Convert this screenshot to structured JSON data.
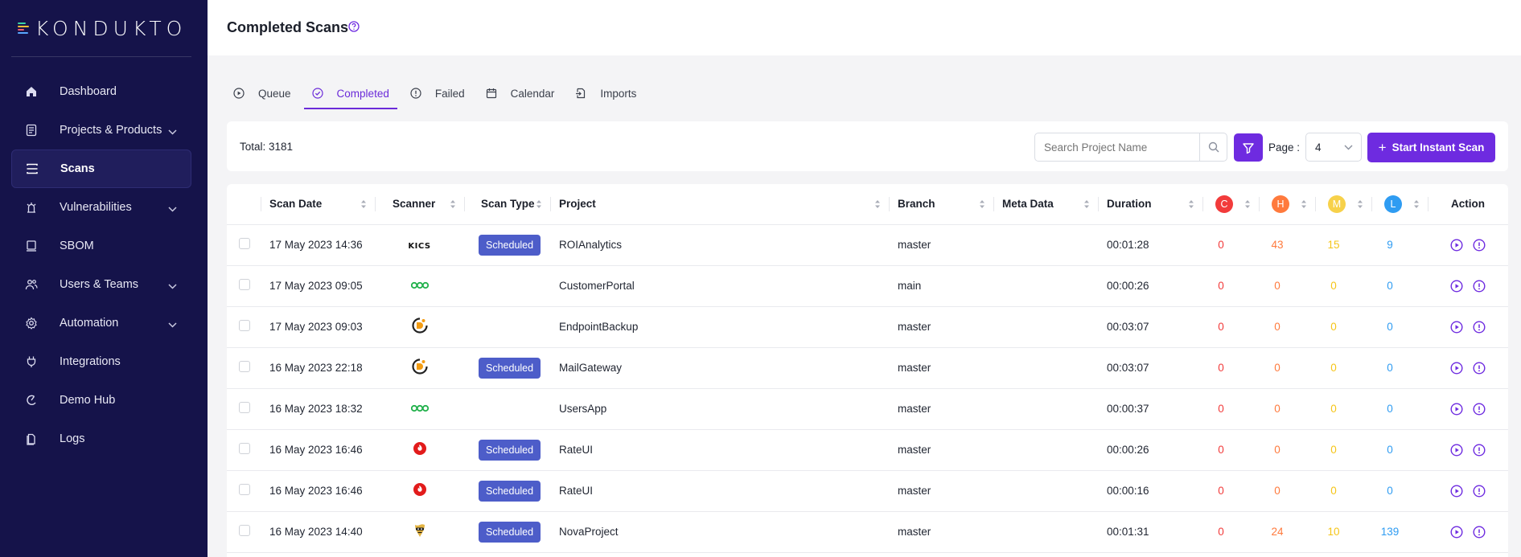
{
  "brand": {
    "name": "KONDUKTO"
  },
  "sidebar": {
    "items": [
      {
        "label": "Dashboard",
        "icon": "home-icon",
        "active": false,
        "chevron": false
      },
      {
        "label": "Projects & Products",
        "icon": "document-list-icon",
        "active": false,
        "chevron": true
      },
      {
        "label": "Scans",
        "icon": "scan-icon",
        "active": true,
        "chevron": false
      },
      {
        "label": "Vulnerabilities",
        "icon": "bug-icon",
        "active": false,
        "chevron": true
      },
      {
        "label": "SBOM",
        "icon": "monitor-icon",
        "active": false,
        "chevron": false
      },
      {
        "label": "Users & Teams",
        "icon": "users-icon",
        "active": false,
        "chevron": true
      },
      {
        "label": "Automation",
        "icon": "gear-icon",
        "active": false,
        "chevron": true
      },
      {
        "label": "Integrations",
        "icon": "plug-icon",
        "active": false,
        "chevron": false
      },
      {
        "label": "Demo Hub",
        "icon": "demo-icon",
        "active": false,
        "chevron": false
      },
      {
        "label": "Logs",
        "icon": "file-icon",
        "active": false,
        "chevron": false
      }
    ]
  },
  "header": {
    "title": "Completed Scans"
  },
  "tabs": [
    {
      "label": "Queue",
      "icon": "play-circle-icon",
      "active": false
    },
    {
      "label": "Completed",
      "icon": "check-circle-icon",
      "active": true
    },
    {
      "label": "Failed",
      "icon": "info-circle-icon",
      "active": false
    },
    {
      "label": "Calendar",
      "icon": "calendar-icon",
      "active": false
    },
    {
      "label": "Imports",
      "icon": "import-icon",
      "active": false
    }
  ],
  "toolbar": {
    "total": "Total: 3181",
    "search_placeholder": "Search Project Name",
    "page_label": "Page :",
    "page_value": "4",
    "start_label": "Start Instant Scan"
  },
  "table": {
    "columns": {
      "scan_date": "Scan Date",
      "scanner": "Scanner",
      "scan_type": "Scan Type",
      "project": "Project",
      "branch": "Branch",
      "meta": "Meta Data",
      "duration": "Duration",
      "critical": "C",
      "high": "H",
      "medium": "M",
      "low": "L",
      "action": "Action"
    },
    "rows": [
      {
        "date": "17 May 2023 14:36",
        "scanner": "kics",
        "scanner_text": "KICS",
        "type": "Scheduled",
        "project": "ROIAnalytics",
        "branch": "master",
        "meta": "",
        "duration": "00:01:28",
        "c": "0",
        "h": "43",
        "m": "15",
        "l": "9"
      },
      {
        "date": "17 May 2023 09:05",
        "scanner": "green-rings",
        "scanner_text": "",
        "type": "",
        "project": "CustomerPortal",
        "branch": "main",
        "meta": "",
        "duration": "00:00:26",
        "c": "0",
        "h": "0",
        "m": "0",
        "l": "0"
      },
      {
        "date": "17 May 2023 09:03",
        "scanner": "dependency-check",
        "scanner_text": "",
        "type": "",
        "project": "EndpointBackup",
        "branch": "master",
        "meta": "",
        "duration": "00:03:07",
        "c": "0",
        "h": "0",
        "m": "0",
        "l": "0"
      },
      {
        "date": "16 May 2023 22:18",
        "scanner": "dependency-check",
        "scanner_text": "",
        "type": "Scheduled",
        "project": "MailGateway",
        "branch": "master",
        "meta": "",
        "duration": "00:03:07",
        "c": "0",
        "h": "0",
        "m": "0",
        "l": "0"
      },
      {
        "date": "16 May 2023 18:32",
        "scanner": "green-rings",
        "scanner_text": "",
        "type": "",
        "project": "UsersApp",
        "branch": "master",
        "meta": "",
        "duration": "00:00:37",
        "c": "0",
        "h": "0",
        "m": "0",
        "l": "0"
      },
      {
        "date": "16 May 2023 16:46",
        "scanner": "red-shield",
        "scanner_text": "",
        "type": "Scheduled",
        "project": "RateUI",
        "branch": "master",
        "meta": "",
        "duration": "00:00:26",
        "c": "0",
        "h": "0",
        "m": "0",
        "l": "0"
      },
      {
        "date": "16 May 2023 16:46",
        "scanner": "red-shield",
        "scanner_text": "",
        "type": "Scheduled",
        "project": "RateUI",
        "branch": "master",
        "meta": "",
        "duration": "00:00:16",
        "c": "0",
        "h": "0",
        "m": "0",
        "l": "0"
      },
      {
        "date": "16 May 2023 14:40",
        "scanner": "bandit-mask",
        "scanner_text": "",
        "type": "Scheduled",
        "project": "NovaProject",
        "branch": "master",
        "meta": "",
        "duration": "00:01:31",
        "c": "0",
        "h": "24",
        "m": "10",
        "l": "139"
      }
    ]
  },
  "colors": {
    "sidebar_bg": "#15134a",
    "accent": "#6e2be0",
    "badge": "#4d5dc9",
    "critical": "#f23b3b",
    "high": "#ff7a3d",
    "medium": "#f5c518",
    "low": "#2f9cf2"
  }
}
